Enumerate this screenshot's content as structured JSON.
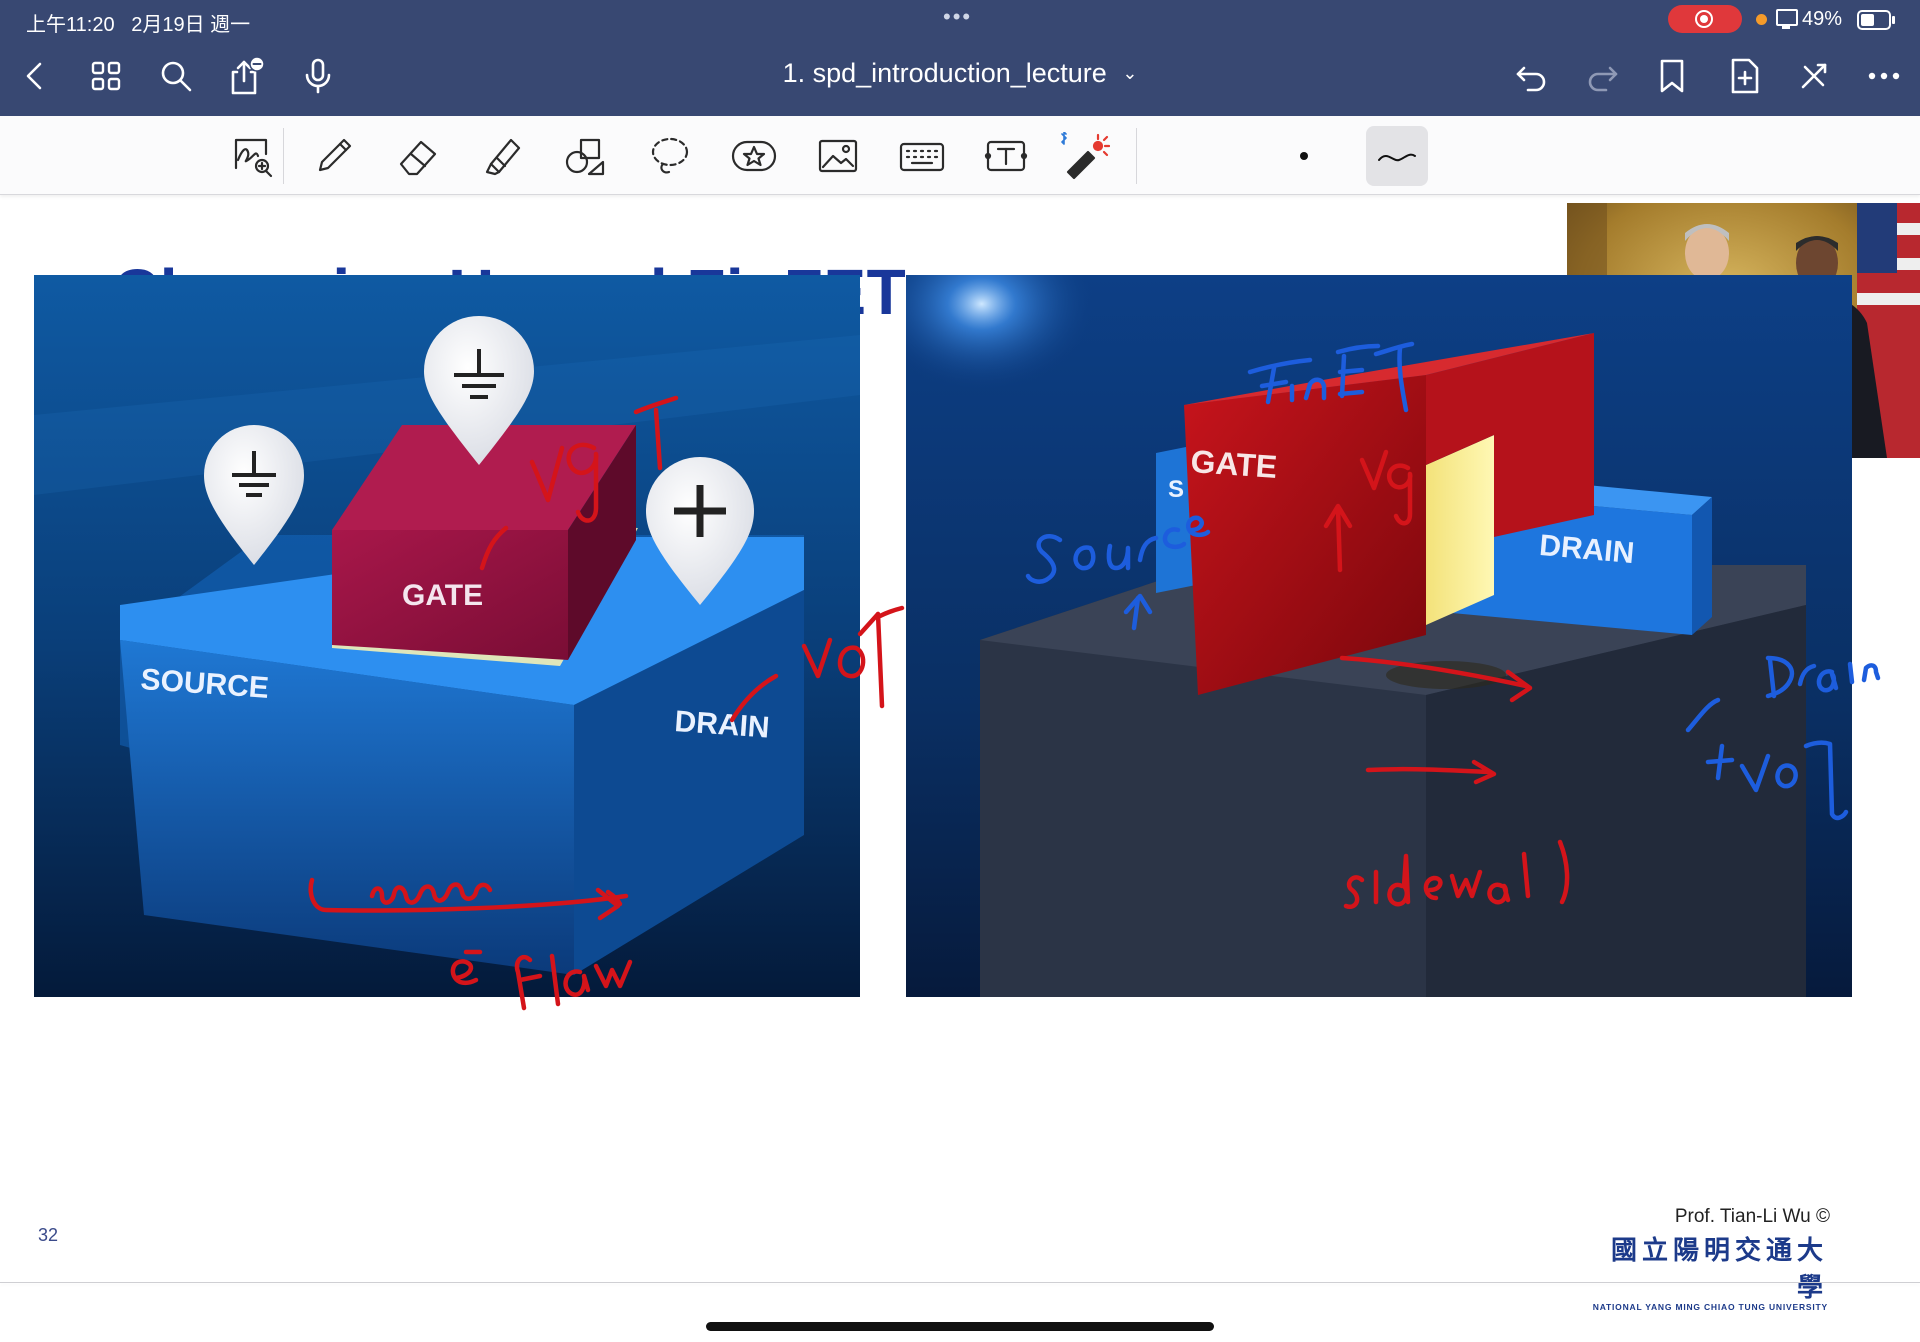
{
  "status_bar": {
    "time": "上午11:20",
    "date": "2月19日 週一",
    "battery_pct": "49%",
    "battery_level": 0.49,
    "recording": true
  },
  "nav": {
    "document_title": "1. spd_introduction_lecture",
    "left_buttons": [
      "back-chevron-icon",
      "grid-thumbnails-icon",
      "search-icon",
      "share-icon",
      "microphone-icon"
    ],
    "right_buttons": [
      "undo-icon",
      "redo-icon",
      "bookmark-icon",
      "add-page-icon",
      "close-tools-icon",
      "more-icon"
    ]
  },
  "toolbar": {
    "tools": [
      "handwriting-zoom-icon",
      "pen-icon",
      "eraser-icon",
      "highlighter-icon",
      "shapes-icon",
      "lasso-icon",
      "sticker-icon",
      "image-icon",
      "keyboard-icon",
      "text-box-icon",
      "laser-pointer-icon"
    ],
    "selected_tool": "pen-icon",
    "stroke_style": "stroke-curve-icon"
  },
  "slide": {
    "title": "Chenming Hu and FinFET",
    "page_number": "32",
    "credit": "Prof. Tian-Li Wu ©",
    "university_cn": "國立陽明交通大學",
    "university_en": "NATIONAL YANG MING CHIAO TUNG UNIVERSITY",
    "left_figure": {
      "labels": {
        "source": "SOURCE",
        "gate": "GATE",
        "drain": "DRAIN"
      }
    },
    "right_figure": {
      "labels": {
        "source": "S",
        "gate": "GATE",
        "drain": "DRAIN"
      }
    }
  },
  "ink_colors": {
    "red": "#d4141a",
    "blue": "#1d5ddd"
  }
}
